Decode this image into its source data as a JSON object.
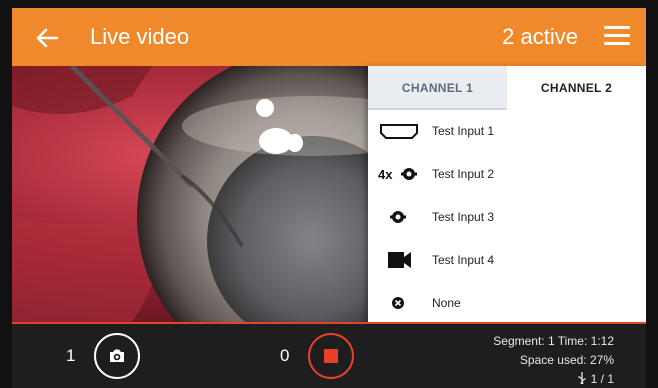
{
  "appbar": {
    "title": "Live video",
    "active_count": "2 active",
    "color": "#f0892c"
  },
  "panel": {
    "tabs": [
      {
        "label": "CHANNEL 1",
        "selected": true
      },
      {
        "label": "CHANNEL 2",
        "selected": false
      }
    ],
    "items": [
      {
        "label": "Test Input 1",
        "icon": "hdmi-icon"
      },
      {
        "label": "Test Input 2",
        "icon": "scope-4x-icon",
        "badge": "4x"
      },
      {
        "label": "Test Input 3",
        "icon": "scope-icon"
      },
      {
        "label": "Test Input 4",
        "icon": "camera-icon"
      },
      {
        "label": "None",
        "icon": "none-icon"
      }
    ]
  },
  "bottombar": {
    "snapshot_count": "1",
    "recording_count": "0",
    "segment_info": "Segment: 1 Time: 1:12",
    "space_used": "Space used: 27%",
    "usb_info": "1 / 1",
    "accent": "#e8402a"
  }
}
